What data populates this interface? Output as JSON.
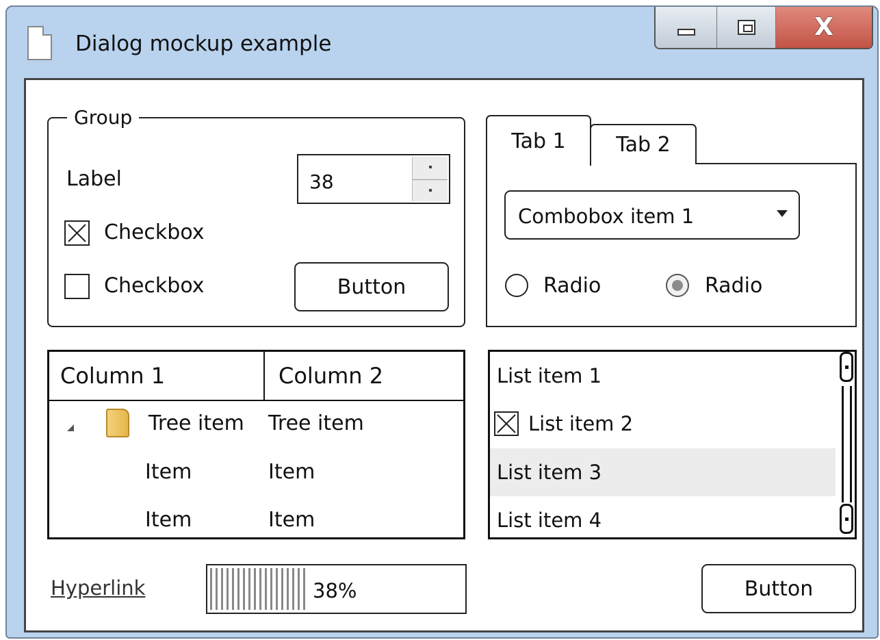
{
  "window": {
    "title": "Dialog mockup example",
    "controls": {
      "minimize": "minimize",
      "maximize": "maximize",
      "close": "X"
    }
  },
  "group": {
    "title": "Group",
    "label": "Label",
    "spinner_value": "38",
    "checkbox1": {
      "label": "Checkbox",
      "checked": true
    },
    "checkbox2": {
      "label": "Checkbox",
      "checked": false
    },
    "button_label": "Button"
  },
  "tabs": {
    "items": [
      {
        "label": "Tab 1",
        "active": true
      },
      {
        "label": "Tab 2",
        "active": false
      }
    ],
    "combobox_value": "Combobox item 1",
    "radio1": {
      "label": "Radio",
      "selected": false
    },
    "radio2": {
      "label": "Radio",
      "selected": true
    }
  },
  "tree": {
    "columns": [
      "Column 1",
      "Column 2"
    ],
    "rows": [
      {
        "col1": "Tree item",
        "col2": "Tree item"
      },
      {
        "col1": "Item",
        "col2": "Item"
      },
      {
        "col1": "Item",
        "col2": "Item"
      }
    ]
  },
  "list": {
    "items": [
      {
        "label": "List item 1",
        "checked": null
      },
      {
        "label": "List item 2",
        "checked": true
      },
      {
        "label": "List item 3",
        "selected": true
      },
      {
        "label": "List item 4"
      }
    ]
  },
  "footer": {
    "hyperlink": "Hyperlink",
    "progress_percent": 38,
    "progress_label": "38%",
    "button_label": "Button"
  },
  "colors": {
    "titlebar": "#b9d3ee",
    "close_button": "#c25446",
    "selected_row": "#ececec"
  }
}
